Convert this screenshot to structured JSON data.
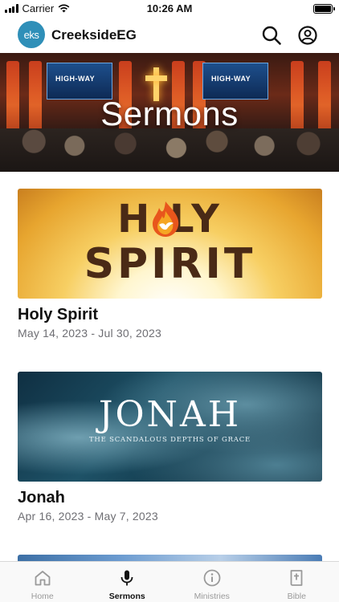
{
  "status_bar": {
    "carrier": "Carrier",
    "time": "10:26 AM"
  },
  "header": {
    "logo_text": "eks",
    "app_name": "CreeksideEG",
    "icons": [
      "search-icon",
      "account-icon"
    ]
  },
  "hero": {
    "title": "Sermons",
    "screen_text": "HIGH-WAY"
  },
  "sermons": [
    {
      "title": "Holy Spirit",
      "dates": "May 14, 2023 - Jul 30, 2023",
      "art_line1": "H LY",
      "art_line2": "SPIRIT"
    },
    {
      "title": "Jonah",
      "dates": "Apr 16, 2023 - May 7, 2023",
      "art_title": "JONAH",
      "art_subtitle": "THE SCANDALOUS DEPTHS OF GRACE"
    }
  ],
  "tabs": [
    {
      "label": "Home",
      "icon": "home-icon",
      "active": false
    },
    {
      "label": "Sermons",
      "icon": "microphone-icon",
      "active": true
    },
    {
      "label": "Ministries",
      "icon": "info-icon",
      "active": false
    },
    {
      "label": "Bible",
      "icon": "bible-icon",
      "active": false
    }
  ],
  "colors": {
    "accent": "#111111",
    "inactive": "#9a9a9a",
    "logo": "#2f8fb8",
    "secondary_text": "#6e6e73"
  }
}
